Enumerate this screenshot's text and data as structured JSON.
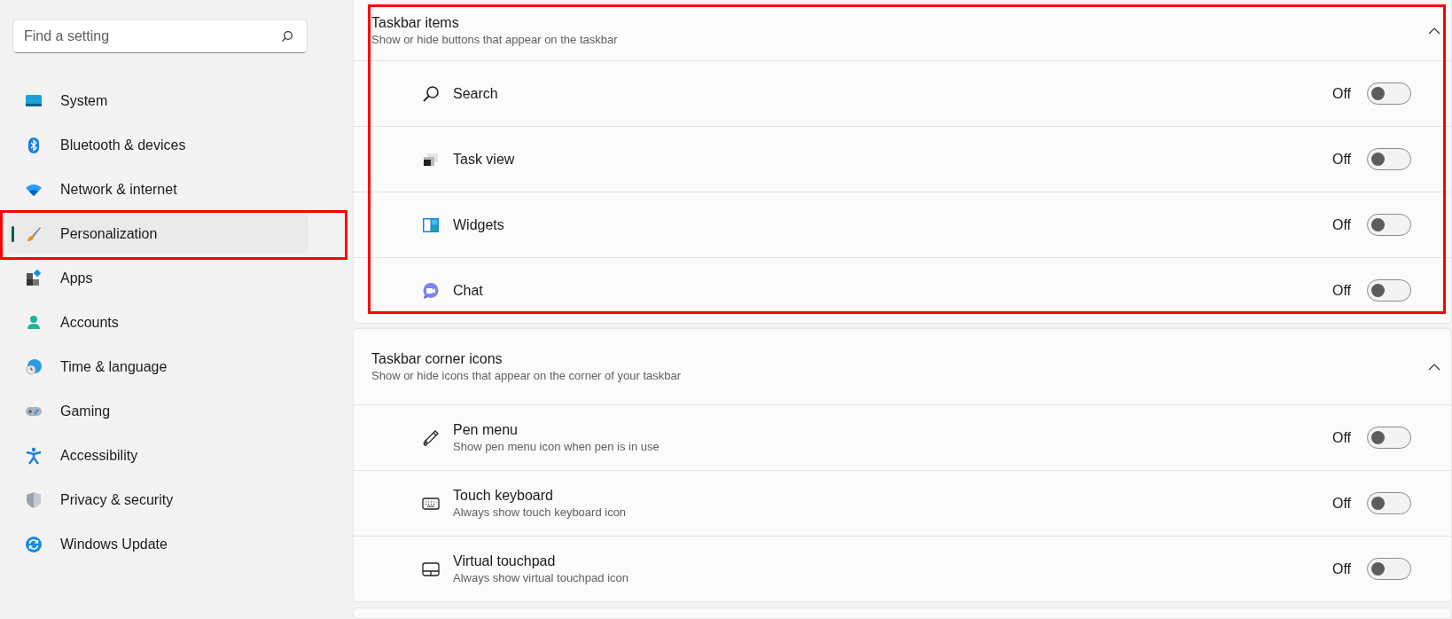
{
  "search": {
    "placeholder": "Find a setting"
  },
  "sidebar": {
    "items": [
      {
        "label": "System",
        "selected": false,
        "highlighted": false
      },
      {
        "label": "Bluetooth & devices",
        "selected": false,
        "highlighted": false
      },
      {
        "label": "Network & internet",
        "selected": false,
        "highlighted": false
      },
      {
        "label": "Personalization",
        "selected": true,
        "highlighted": true
      },
      {
        "label": "Apps",
        "selected": false,
        "highlighted": false
      },
      {
        "label": "Accounts",
        "selected": false,
        "highlighted": false
      },
      {
        "label": "Time & language",
        "selected": false,
        "highlighted": false
      },
      {
        "label": "Gaming",
        "selected": false,
        "highlighted": false
      },
      {
        "label": "Accessibility",
        "selected": false,
        "highlighted": false
      },
      {
        "label": "Privacy & security",
        "selected": false,
        "highlighted": false
      },
      {
        "label": "Windows Update",
        "selected": false,
        "highlighted": false
      }
    ]
  },
  "sections": [
    {
      "title": "Taskbar items",
      "subtitle": "Show or hide buttons that appear on the taskbar",
      "expanded": true,
      "highlighted": true,
      "items": [
        {
          "label": "Search",
          "state": "Off",
          "on": false
        },
        {
          "label": "Task view",
          "state": "Off",
          "on": false
        },
        {
          "label": "Widgets",
          "state": "Off",
          "on": false
        },
        {
          "label": "Chat",
          "state": "Off",
          "on": false
        }
      ]
    },
    {
      "title": "Taskbar corner icons",
      "subtitle": "Show or hide icons that appear on the corner of your taskbar",
      "expanded": true,
      "highlighted": false,
      "items": [
        {
          "label": "Pen menu",
          "description": "Show pen menu icon when pen is in use",
          "state": "Off",
          "on": false
        },
        {
          "label": "Touch keyboard",
          "description": "Always show touch keyboard icon",
          "state": "Off",
          "on": false
        },
        {
          "label": "Virtual touchpad",
          "description": "Always show virtual touchpad icon",
          "state": "Off",
          "on": false
        }
      ]
    }
  ]
}
